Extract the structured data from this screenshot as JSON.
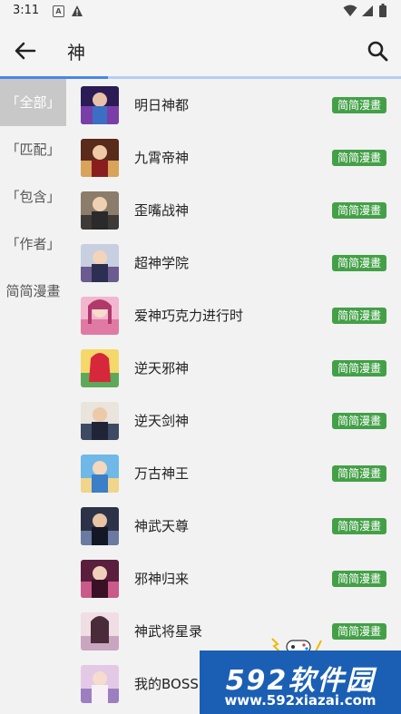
{
  "status_bar": {
    "time": "3:11",
    "notification_a": "A",
    "icons": [
      "A-notification-icon",
      "warning-icon",
      "wifi-icon",
      "signal-icon",
      "battery-icon"
    ]
  },
  "toolbar": {
    "query": "神",
    "back_icon": "arrow-left-icon",
    "search_icon": "search-icon"
  },
  "progress": {
    "fraction": 0.27
  },
  "filters": [
    {
      "label": "「全部」",
      "active": true
    },
    {
      "label": "「匹配」",
      "active": false
    },
    {
      "label": "「包含」",
      "active": false
    },
    {
      "label": "「作者」",
      "active": false
    },
    {
      "label": "简简漫畫",
      "active": false
    }
  ],
  "results": [
    {
      "title": "明日神都",
      "badge": "简简漫畫"
    },
    {
      "title": "九霄帝神",
      "badge": "简简漫畫"
    },
    {
      "title": "歪嘴战神",
      "badge": "简简漫畫"
    },
    {
      "title": "超神学院",
      "badge": "简简漫畫"
    },
    {
      "title": "爱神巧克力进行时",
      "badge": "简简漫畫"
    },
    {
      "title": "逆天邪神",
      "badge": "简简漫畫"
    },
    {
      "title": "逆天剑神",
      "badge": "简简漫畫"
    },
    {
      "title": "万古神王",
      "badge": "简简漫畫"
    },
    {
      "title": "神武天尊",
      "badge": "简简漫畫"
    },
    {
      "title": "邪神归来",
      "badge": "简简漫畫"
    },
    {
      "title": "神武将星录",
      "badge": "简简漫畫"
    },
    {
      "title": "我的BOSS",
      "badge": ""
    }
  ],
  "watermark": {
    "logo": "592软件园",
    "url": "www.592xiazai.com"
  },
  "colors": {
    "accent": "#4a86e8",
    "badge": "#43a047",
    "active_filter_bg": "#c8c8c8",
    "watermark_bg": "#1b5fb5"
  }
}
